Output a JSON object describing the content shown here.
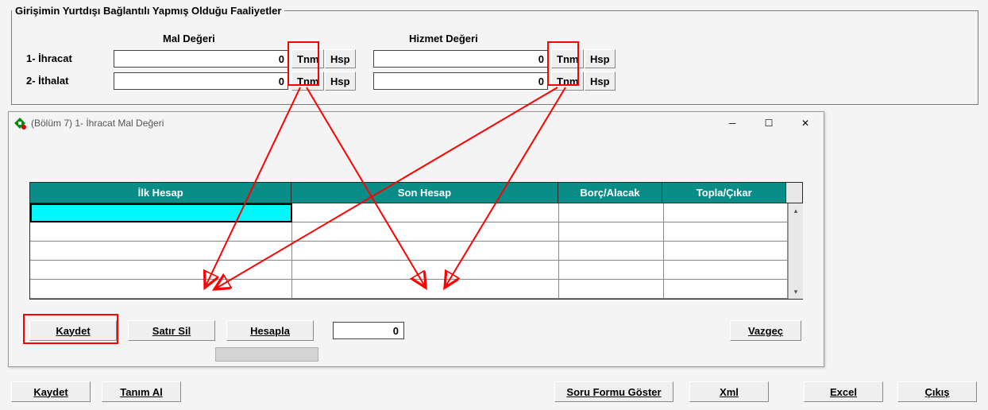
{
  "group": {
    "legend": "Girişimin Yurtdışı Bağlantılı Yapmış Olduğu Faaliyetler",
    "headers": {
      "mal": "Mal Değeri",
      "hizmet": "Hizmet Değeri"
    },
    "rows": [
      {
        "label": "1-  İhracat",
        "mal": "0",
        "hizmet": "0",
        "tnm": "Tnm",
        "hsp": "Hsp"
      },
      {
        "label": "2-  İthalat",
        "mal": "0",
        "hizmet": "0",
        "tnm": "Tnm",
        "hsp": "Hsp"
      }
    ]
  },
  "dialog": {
    "title": "(Bölüm 7)  1-  İhracat Mal Değeri",
    "columns": {
      "ilk": "İlk Hesap",
      "son": "Son Hesap",
      "borc": "Borç/Alacak",
      "topla": "Topla/Çıkar"
    },
    "buttons": {
      "kaydet": "Kaydet",
      "satirsil": "Satır Sil",
      "hesapla": "Hesapla",
      "vazgec": "Vazgeç"
    },
    "calc_value": "0"
  },
  "bottom": {
    "kaydet": "Kaydet",
    "tanim_al": "Tanım Al",
    "soru_formu": "Soru Formu Göster",
    "xml": "Xml",
    "excel": "Excel",
    "cikis": "Çıkış"
  }
}
